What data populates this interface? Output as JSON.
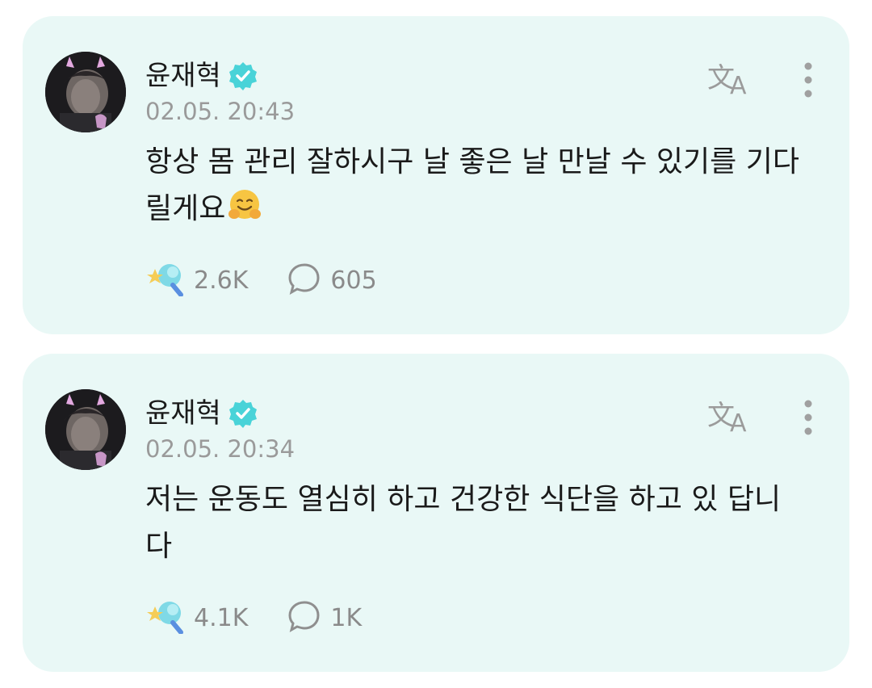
{
  "colors": {
    "card_bg": "#e9f8f6",
    "verified_badge": "#49d3d8",
    "muted_text": "#9a9a9a",
    "icon_gray": "#9b9b9b"
  },
  "posts": [
    {
      "author": "윤재혁",
      "verified_icon": "verified-badge-icon",
      "timestamp": "02.05. 20:43",
      "text": "항상 몸 관리 잘하시구 날 좋은 날 만날 수 있기를 기다릴게요",
      "emoji": "🤗",
      "likes": "2.6K",
      "comments": "605",
      "translate_icon": "translate-icon",
      "more_icon": "more-vertical-icon"
    },
    {
      "author": "윤재혁",
      "verified_icon": "verified-badge-icon",
      "timestamp": "02.05. 20:34",
      "text": "저는 운동도 열심히 하고 건강한 식단을 하고 있 답니다",
      "likes": "4.1K",
      "comments": "1K",
      "translate_icon": "translate-icon",
      "more_icon": "more-vertical-icon"
    }
  ]
}
